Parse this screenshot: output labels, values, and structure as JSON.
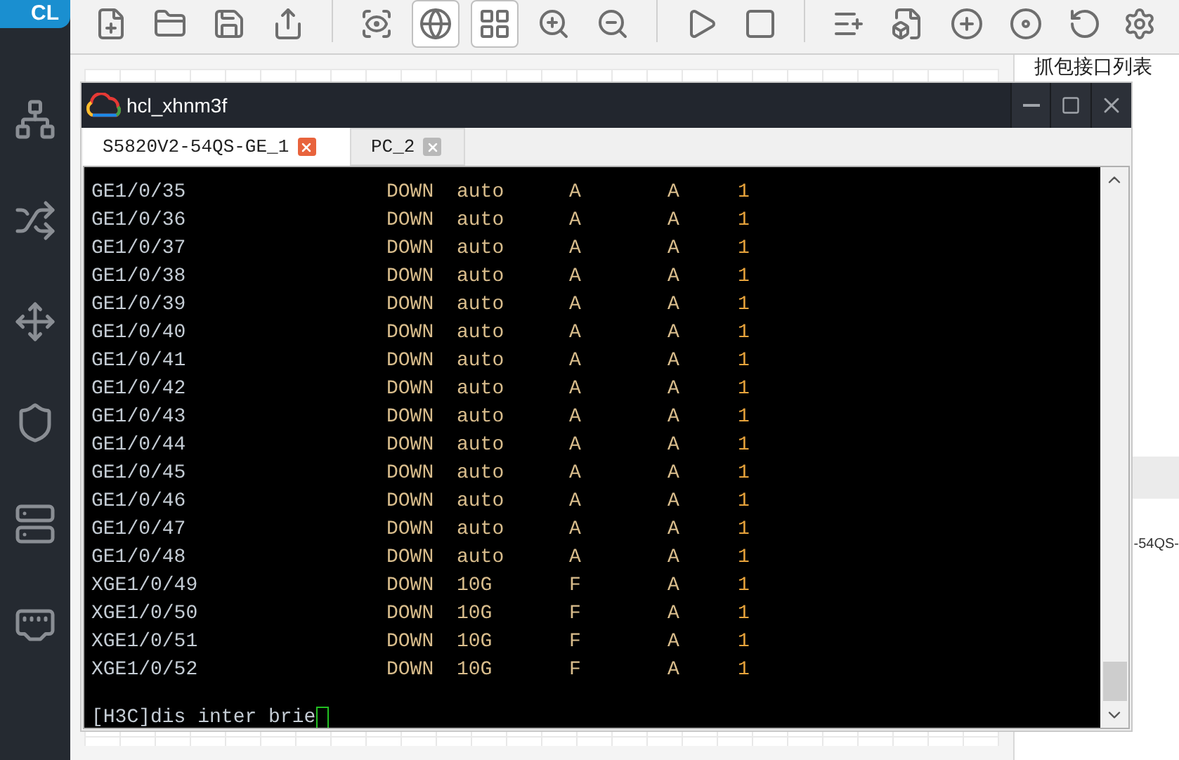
{
  "app": {
    "logo_text": "CL",
    "toolbar": [
      {
        "selected": false
      },
      {
        "selected": false
      },
      {
        "selected": false
      },
      {
        "selected": false
      },
      {
        "selected": false
      },
      {
        "selected": true
      },
      {
        "selected": true
      },
      {
        "selected": false
      },
      {
        "selected": false
      },
      {
        "selected": false
      },
      {
        "selected": false
      },
      {
        "selected": false
      },
      {
        "selected": false
      },
      {
        "selected": false
      },
      {
        "selected": false
      },
      {
        "selected": false
      }
    ],
    "right_panel": {
      "title": "抓包接口列表",
      "item": "-54QS-"
    }
  },
  "window": {
    "title": "hcl_xhnm3f",
    "tabs": [
      {
        "label": "S5820V2-54QS-GE_1",
        "selected": true
      },
      {
        "label": "PC_2",
        "selected": false
      }
    ],
    "terminal": {
      "rows": [
        {
          "cells": [
            "GE1/0/35",
            "DOWN",
            "auto",
            "A",
            "A",
            "1"
          ]
        },
        {
          "cells": [
            "GE1/0/36",
            "DOWN",
            "auto",
            "A",
            "A",
            "1"
          ]
        },
        {
          "cells": [
            "GE1/0/37",
            "DOWN",
            "auto",
            "A",
            "A",
            "1"
          ]
        },
        {
          "cells": [
            "GE1/0/38",
            "DOWN",
            "auto",
            "A",
            "A",
            "1"
          ]
        },
        {
          "cells": [
            "GE1/0/39",
            "DOWN",
            "auto",
            "A",
            "A",
            "1"
          ]
        },
        {
          "cells": [
            "GE1/0/40",
            "DOWN",
            "auto",
            "A",
            "A",
            "1"
          ]
        },
        {
          "cells": [
            "GE1/0/41",
            "DOWN",
            "auto",
            "A",
            "A",
            "1"
          ]
        },
        {
          "cells": [
            "GE1/0/42",
            "DOWN",
            "auto",
            "A",
            "A",
            "1"
          ]
        },
        {
          "cells": [
            "GE1/0/43",
            "DOWN",
            "auto",
            "A",
            "A",
            "1"
          ]
        },
        {
          "cells": [
            "GE1/0/44",
            "DOWN",
            "auto",
            "A",
            "A",
            "1"
          ]
        },
        {
          "cells": [
            "GE1/0/45",
            "DOWN",
            "auto",
            "A",
            "A",
            "1"
          ]
        },
        {
          "cells": [
            "GE1/0/46",
            "DOWN",
            "auto",
            "A",
            "A",
            "1"
          ]
        },
        {
          "cells": [
            "GE1/0/47",
            "DOWN",
            "auto",
            "A",
            "A",
            "1"
          ]
        },
        {
          "cells": [
            "GE1/0/48",
            "DOWN",
            "auto",
            "A",
            "A",
            "1"
          ]
        },
        {
          "cells": [
            "XGE1/0/49",
            "DOWN",
            "10G",
            "F",
            "A",
            "1"
          ]
        },
        {
          "cells": [
            "XGE1/0/50",
            "DOWN",
            "10G",
            "F",
            "A",
            "1"
          ]
        },
        {
          "cells": [
            "XGE1/0/51",
            "DOWN",
            "10G",
            "F",
            "A",
            "1"
          ]
        },
        {
          "cells": [
            "XGE1/0/52",
            "DOWN",
            "10G",
            "F",
            "A",
            "1"
          ]
        }
      ],
      "prompt": "[H3C]dis inter brie"
    }
  }
}
